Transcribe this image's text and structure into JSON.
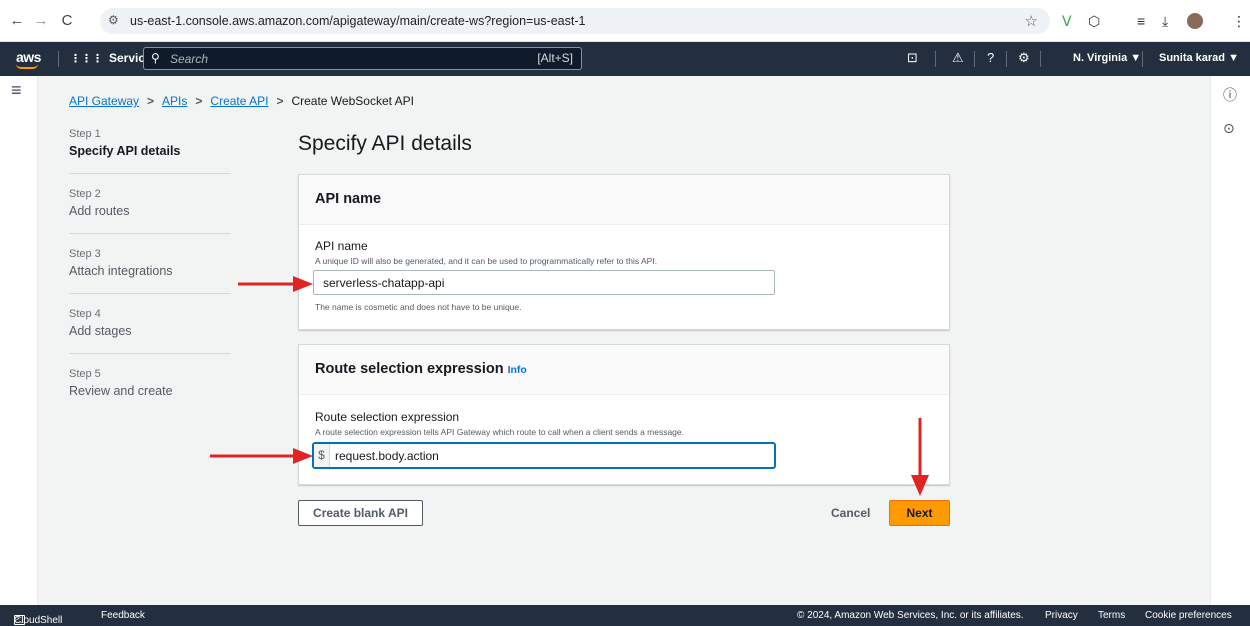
{
  "browser": {
    "url": "us-east-1.console.aws.amazon.com/apigateway/main/create-ws?region=us-east-1",
    "back_icon": "←",
    "forward_icon": "→",
    "reload_icon": "C",
    "site_icon": "⚙",
    "star_icon": "☆",
    "ext_icons": [
      "ᐯ",
      "⬡",
      "≡",
      "⤓",
      "⋮"
    ]
  },
  "aws_nav": {
    "logo": "aws",
    "services_label": "Services",
    "grid_icon": "⋮⋮⋮",
    "search_placeholder": "Search",
    "search_shortcut": "[Alt+S]",
    "cloudshell_icon": "⊡",
    "bell_icon": "⚠",
    "help_icon": "?",
    "settings_icon": "⚙",
    "region": "N. Virginia ▼",
    "user": "Sunita karad ▼"
  },
  "breadcrumb": {
    "items": [
      "API Gateway",
      "APIs",
      "Create API"
    ],
    "current": "Create WebSocket API",
    "sep": ">"
  },
  "steps": [
    {
      "num": "Step 1",
      "title": "Specify API details"
    },
    {
      "num": "Step 2",
      "title": "Add routes"
    },
    {
      "num": "Step 3",
      "title": "Attach integrations"
    },
    {
      "num": "Step 4",
      "title": "Add stages"
    },
    {
      "num": "Step 5",
      "title": "Review and create"
    }
  ],
  "page_title": "Specify API details",
  "api_name_panel": {
    "header": "API name",
    "label": "API name",
    "description": "A unique ID will also be generated, and it can be used to programmatically refer to this API.",
    "value": "serverless-chatapp-api",
    "hint": "The name is cosmetic and does not have to be unique."
  },
  "route_panel": {
    "header": "Route selection expression",
    "info": "Info",
    "label": "Route selection expression",
    "description": "A route selection expression tells API Gateway which route to call when a client sends a message.",
    "prefix": "$",
    "value": "request.body.action"
  },
  "actions": {
    "create_blank": "Create blank API",
    "cancel": "Cancel",
    "next": "Next"
  },
  "rails": {
    "hamburger_icon": "≡",
    "info_icon": "ⓘ",
    "settings_icon": "⊙"
  },
  "footer": {
    "cloudshell": "CloudShell",
    "cloudshell_icon": ">_",
    "feedback": "Feedback",
    "copyright": "© 2024, Amazon Web Services, Inc. or its affiliates.",
    "privacy": "Privacy",
    "terms": "Terms",
    "cookies": "Cookie preferences"
  },
  "colors": {
    "aws_nav": "#232f3e",
    "primary_orange": "#ff9900",
    "link_blue": "#0972d3",
    "arrow_red": "#e02424"
  }
}
